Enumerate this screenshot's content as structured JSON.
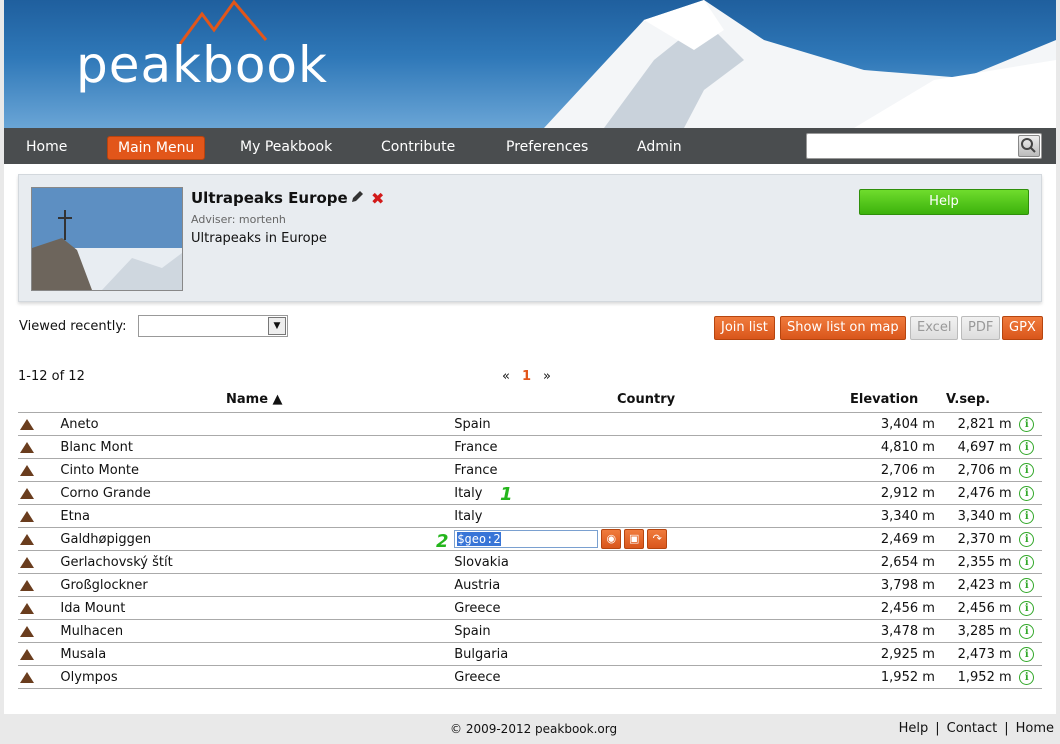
{
  "brand": {
    "logo_text": "peakbook"
  },
  "nav": {
    "items": [
      {
        "label": "Home"
      },
      {
        "label": "Main Menu"
      },
      {
        "label": "My Peakbook"
      },
      {
        "label": "Contribute"
      },
      {
        "label": "Preferences"
      },
      {
        "label": "Admin"
      }
    ],
    "active": "Main Menu",
    "search": {
      "value": "",
      "placeholder": ""
    }
  },
  "list": {
    "title": "Ultrapeaks Europe",
    "adviser": "Adviser: mortenh",
    "description": "Ultrapeaks in Europe",
    "help_label": "Help"
  },
  "viewed_recently": {
    "label": "Viewed recently:",
    "value": ""
  },
  "actions": {
    "join": "Join list",
    "map": "Show list on map",
    "excel": "Excel",
    "pdf": "PDF",
    "gpx": "GPX"
  },
  "pagination": {
    "count": "1-12 of 12",
    "prev": "«",
    "current": "1",
    "next": "»"
  },
  "table": {
    "headers": {
      "name": "Name ▲",
      "country": "Country",
      "elevation": "Elevation",
      "vsep": "V.sep."
    },
    "rows": [
      {
        "name": "Aneto",
        "country": "Spain",
        "elevation": "3,404",
        "vsep": "2,821"
      },
      {
        "name": "Blanc Mont",
        "country": "France",
        "elevation": "4,810",
        "vsep": "4,697"
      },
      {
        "name": "Cinto Monte",
        "country": "France",
        "elevation": "2,706",
        "vsep": "2,706"
      },
      {
        "name": "Corno Grande",
        "country": "Italy",
        "elevation": "2,912",
        "vsep": "2,476"
      },
      {
        "name": "Etna",
        "country": "Italy",
        "elevation": "3,340",
        "vsep": "3,340"
      },
      {
        "name": "Galdhøpiggen",
        "country": "",
        "edit_value": "$geo:2",
        "elevation": "2,469",
        "vsep": "2,370"
      },
      {
        "name": "Gerlachovský štít",
        "country": "Slovakia",
        "elevation": "2,654",
        "vsep": "2,355"
      },
      {
        "name": "Großglockner",
        "country": "Austria",
        "elevation": "3,798",
        "vsep": "2,423"
      },
      {
        "name": "Ida Mount",
        "country": "Greece",
        "elevation": "2,456",
        "vsep": "2,456"
      },
      {
        "name": "Mulhacen",
        "country": "Spain",
        "elevation": "3,478",
        "vsep": "3,285"
      },
      {
        "name": "Musala",
        "country": "Bulgaria",
        "elevation": "2,925",
        "vsep": "2,473"
      },
      {
        "name": "Olympos",
        "country": "Greece",
        "elevation": "1,952",
        "vsep": "1,952"
      }
    ],
    "unit": "m"
  },
  "annotations": {
    "marker1": "1",
    "marker2": "2"
  },
  "footer": {
    "copyright": "© 2009-2012 peakbook.org",
    "links": [
      "Help",
      "Contact",
      "Home"
    ],
    "separator": "|"
  },
  "colors": {
    "accent": "#e2561a",
    "help_green": "#3cb20c",
    "info_green": "#33a82a",
    "nav_bg": "#4a4d4f"
  }
}
